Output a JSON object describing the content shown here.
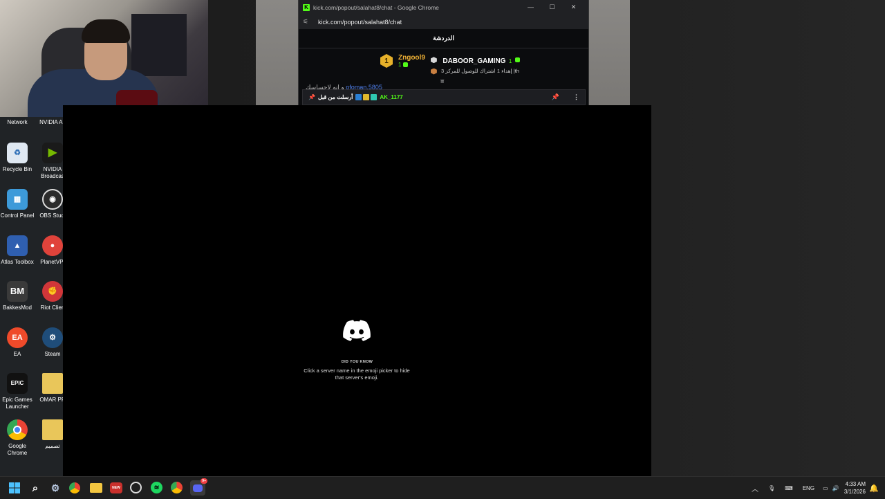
{
  "desktop": {
    "icons": [
      {
        "label": "Network",
        "icon": "network-icon"
      },
      {
        "label": "NVIDIA Ap",
        "icon": "nvidia-app-icon"
      },
      {
        "label": "Recycle Bin",
        "icon": "recycle-bin-icon"
      },
      {
        "label": "NVIDIA Broadcas",
        "icon": "nvidia-broadcast-icon"
      },
      {
        "label": "Control Panel",
        "icon": "control-panel-icon"
      },
      {
        "label": "OBS Studi",
        "icon": "obs-studio-icon"
      },
      {
        "label": "Atlas Toolbox",
        "icon": "atlas-toolbox-icon"
      },
      {
        "label": "PlanetVPI",
        "icon": "planet-vpn-icon"
      },
      {
        "label": "BakkesMod",
        "icon": "bakkesmod-icon"
      },
      {
        "label": "Riot Clien",
        "icon": "riot-client-icon"
      },
      {
        "label": "EA",
        "icon": "ea-icon"
      },
      {
        "label": "Steam",
        "icon": "steam-icon"
      },
      {
        "label": "Epic Games Launcher",
        "icon": "epic-games-icon"
      },
      {
        "label": "OMAR PR",
        "icon": "folder-icon"
      },
      {
        "label": "Google Chrome",
        "icon": "chrome-icon"
      },
      {
        "label": "تصميم",
        "icon": "folder-icon"
      }
    ]
  },
  "chrome": {
    "window_title": "kick.com/popout/salahat8/chat - Google Chrome",
    "url": "kick.com/popout/salahat8/chat",
    "controls": {
      "minimize": "—",
      "maximize": "☐",
      "close": "✕"
    }
  },
  "kick_chat": {
    "header": "الدردشة",
    "leaderboard": {
      "first": {
        "rank": "1",
        "name": "Zngool9",
        "count": "1"
      },
      "second": {
        "name": "DABOOR_GAMING",
        "count": "1"
      },
      "gift_line": "إهداء 1 اشتراك للوصول للمركز 3 |th"
    },
    "partial_message": {
      "prefix": "و انه لاحساسك",
      "name": "ofoman.5805"
    },
    "pinned": {
      "text": "أرسلت من قبل",
      "user": "AK_1177"
    }
  },
  "discord": {
    "did_you_know": "DID YOU KNOW",
    "tip": "Click a server name in the emoji picker to hide that server's emoji."
  },
  "taskbar": {
    "lang": "ENG",
    "time": "4:33 AM",
    "date": "3/1/2026",
    "discord_badge": "9+"
  },
  "colors": {
    "kick_green": "#53fc18",
    "gold": "#f2b336",
    "discord_bg": "#000000"
  }
}
